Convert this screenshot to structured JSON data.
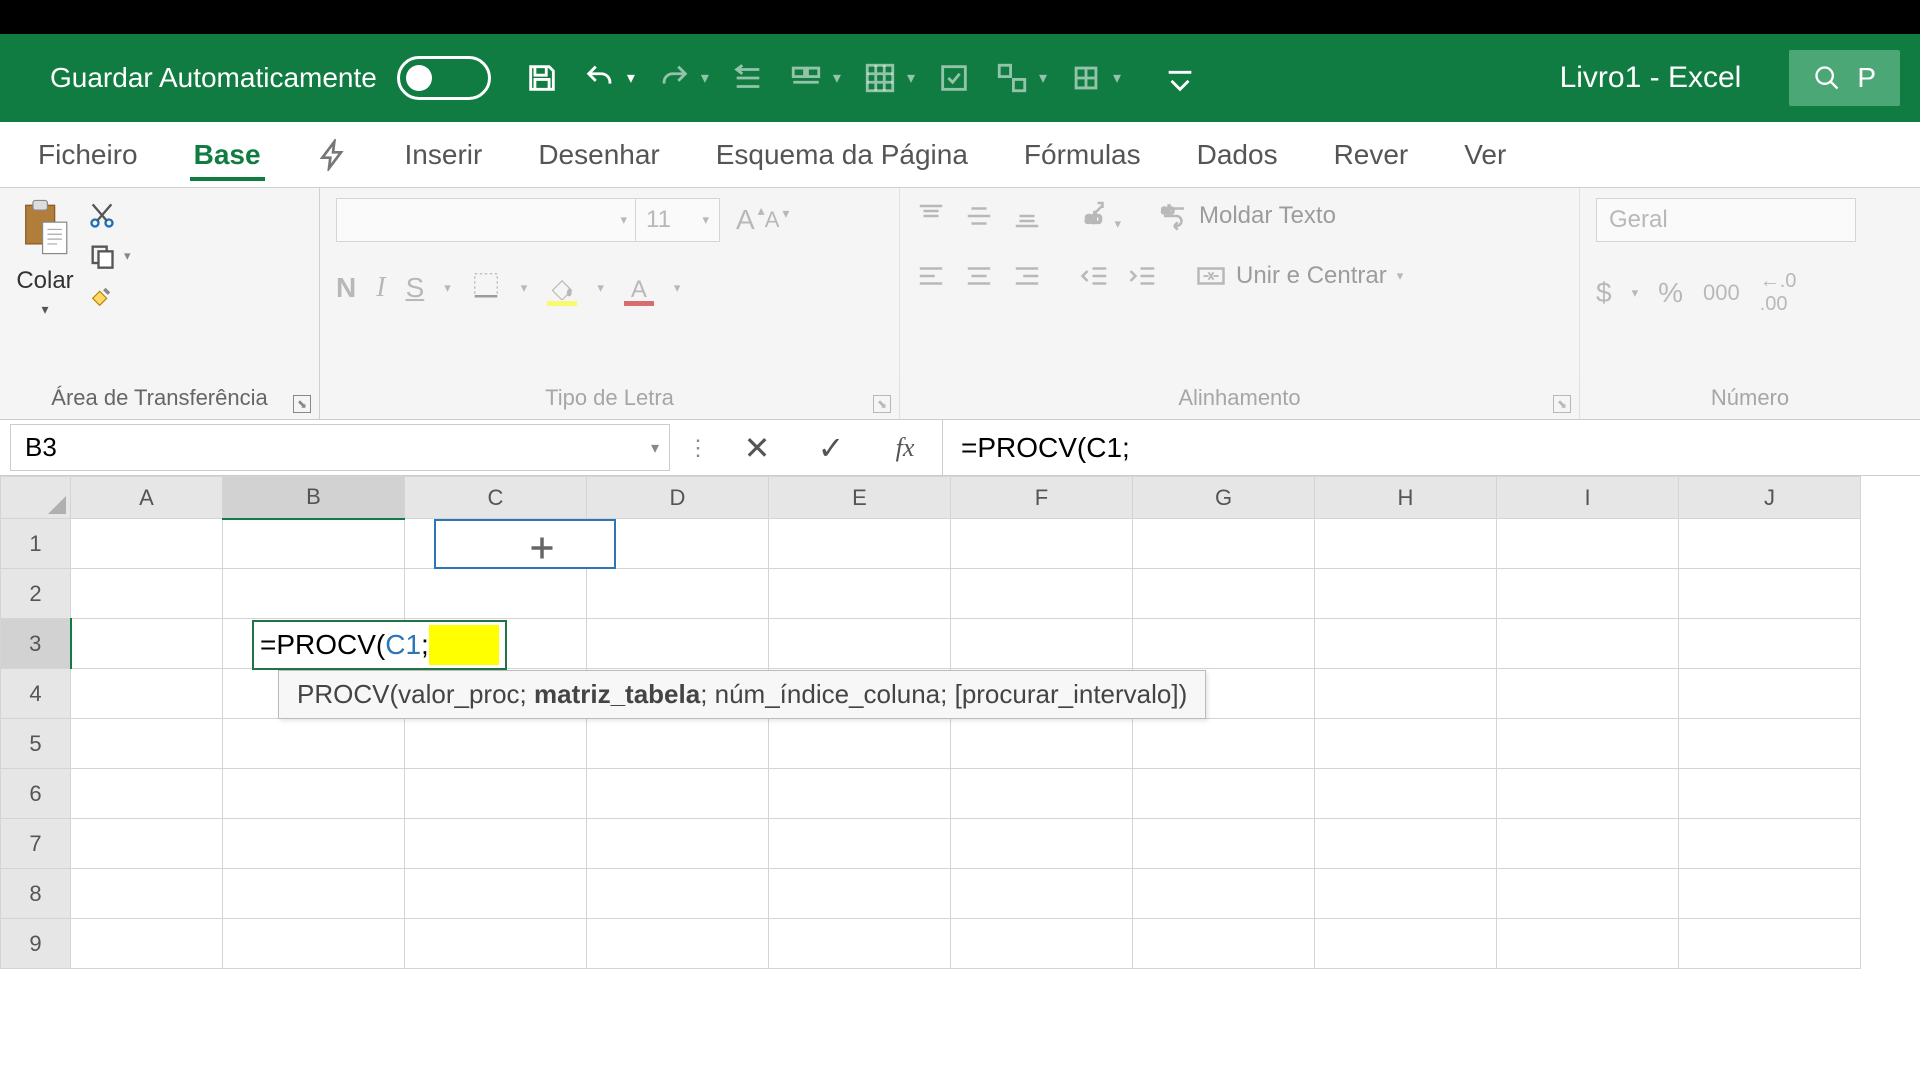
{
  "titlebar": {
    "autosave_label": "Guardar Automaticamente",
    "doc_title": "Livro1  -  Excel",
    "search_placeholder": "P"
  },
  "tabs": {
    "file": "Ficheiro",
    "home": "Base",
    "insert": "Inserir",
    "draw": "Desenhar",
    "pagelayout": "Esquema da Página",
    "formulas": "Fórmulas",
    "data": "Dados",
    "review": "Rever",
    "view": "Ver"
  },
  "ribbon": {
    "clipboard": {
      "paste": "Colar",
      "group": "Área de Transferência"
    },
    "font": {
      "size": "11",
      "group": "Tipo de Letra",
      "bold": "N",
      "italic": "I",
      "underline": "S"
    },
    "align": {
      "wrap": "Moldar Texto",
      "merge": "Unir e Centrar",
      "group": "Alinhamento"
    },
    "number": {
      "format": "Geral",
      "group": "Número",
      "thousands": "000"
    }
  },
  "formulabar": {
    "name_box": "B3",
    "formula": "=PROCV(C1;"
  },
  "cell_edit": {
    "prefix": "=PROCV(",
    "ref": "C1",
    "suffix": ";"
  },
  "tooltip": {
    "fn": "PROCV",
    "arg1": "valor_proc",
    "arg2": "matriz_tabela",
    "arg3": "núm_índice_coluna",
    "arg4": "[procurar_intervalo]"
  },
  "columns": [
    "A",
    "B",
    "C",
    "D",
    "E",
    "F",
    "G",
    "H",
    "I",
    "J"
  ],
  "rows": [
    "1",
    "2",
    "3",
    "4",
    "5",
    "6",
    "7",
    "8",
    "9"
  ]
}
